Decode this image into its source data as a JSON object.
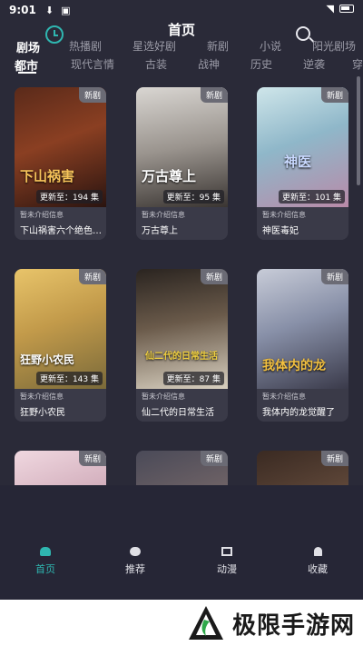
{
  "status_bar": {
    "time": "9:01",
    "icons": [
      "download-icon",
      "image-icon",
      "wifi-icon",
      "battery-icon"
    ]
  },
  "header": {
    "title": "首页"
  },
  "channel_tabs": [
    "剧场",
    "热播剧",
    "星选好剧",
    "新剧",
    "小说",
    "阳光剧场"
  ],
  "category_tabs": [
    "都市",
    "现代言情",
    "古装",
    "战神",
    "历史",
    "逆袭",
    "穿"
  ],
  "cards": [
    {
      "badge": "新剧",
      "poster_title": "下山祸害",
      "progress": "更新至：194 集",
      "meta": "暂未介绍信息",
      "name": "下山祸害六个绝色…"
    },
    {
      "badge": "新剧",
      "poster_title": "万古尊上",
      "progress": "更新至：95 集",
      "meta": "暂未介绍信息",
      "name": "万古尊上"
    },
    {
      "badge": "新剧",
      "poster_title": "神医",
      "progress": "更新至：101 集",
      "meta": "暂未介绍信息",
      "name": "神医毒妃"
    },
    {
      "badge": "新剧",
      "poster_title": "狂野小农民",
      "progress": "更新至：143 集",
      "meta": "暂未介绍信息",
      "name": "狂野小农民"
    },
    {
      "badge": "新剧",
      "poster_title": "仙二代的日常生活",
      "progress": "更新至：87 集",
      "meta": "暂未介绍信息",
      "name": "仙二代的日常生活"
    },
    {
      "badge": "新剧",
      "poster_title": "我体内的龙",
      "progress": "",
      "meta": "暂未介绍信息",
      "name": "我体内的龙觉醒了"
    },
    {
      "badge": "新剧",
      "poster_title": "",
      "progress": "",
      "meta": "",
      "name": ""
    },
    {
      "badge": "新剧",
      "poster_title": "",
      "progress": "",
      "meta": "",
      "name": ""
    },
    {
      "badge": "新剧",
      "poster_title": "",
      "progress": "",
      "meta": "",
      "name": ""
    }
  ],
  "bottom_nav": [
    {
      "label": "首页",
      "icon": "home-icon",
      "active": true
    },
    {
      "label": "推荐",
      "icon": "chat-icon",
      "active": false
    },
    {
      "label": "动漫",
      "icon": "expand-icon",
      "active": false
    },
    {
      "label": "收藏",
      "icon": "bell-icon",
      "active": false
    }
  ],
  "watermark": {
    "text": "极限手游网"
  },
  "colors": {
    "accent": "#2fb6b0",
    "background": "#2a2a38",
    "card": "#3a3a48"
  }
}
